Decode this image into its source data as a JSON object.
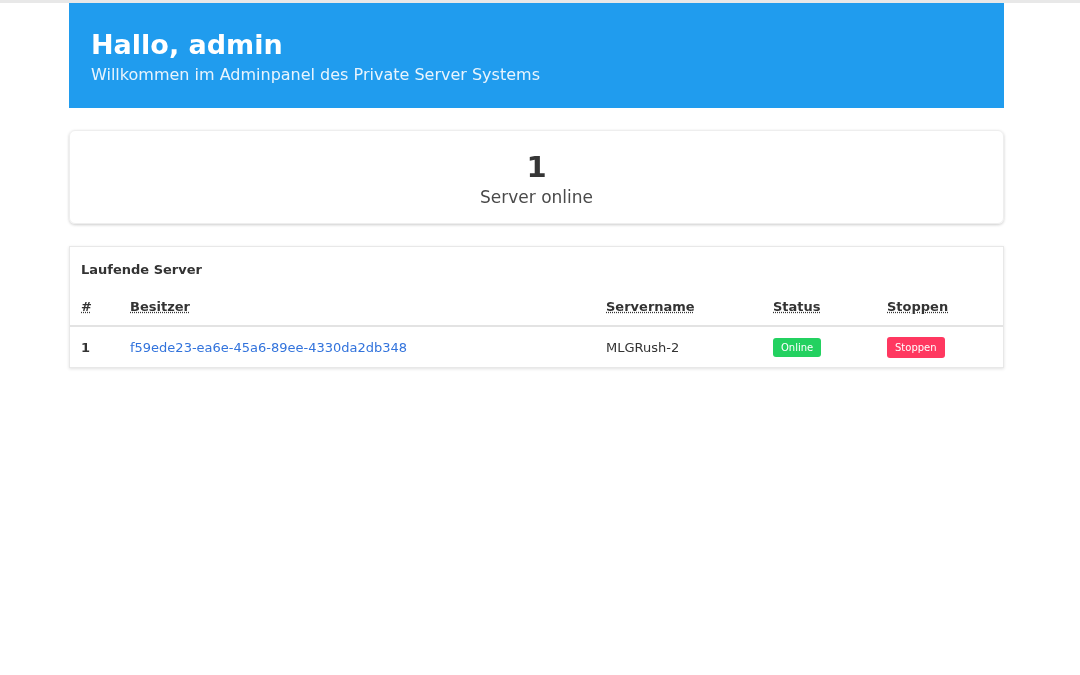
{
  "header": {
    "title": "Hallo, admin",
    "subtitle": "Willkommen im Adminpanel des Private Server Systems"
  },
  "stat": {
    "value": "1",
    "label": "Server online"
  },
  "table": {
    "title": "Laufende Server",
    "columns": [
      "#",
      "Besitzer",
      "Servername",
      "Status",
      "Stoppen"
    ],
    "rows": [
      {
        "index": "1",
        "owner": "f59ede23-ea6e-45a6-89ee-4330da2db348",
        "server_name": "MLGRush-2",
        "status": "Online",
        "action": "Stoppen"
      }
    ]
  }
}
